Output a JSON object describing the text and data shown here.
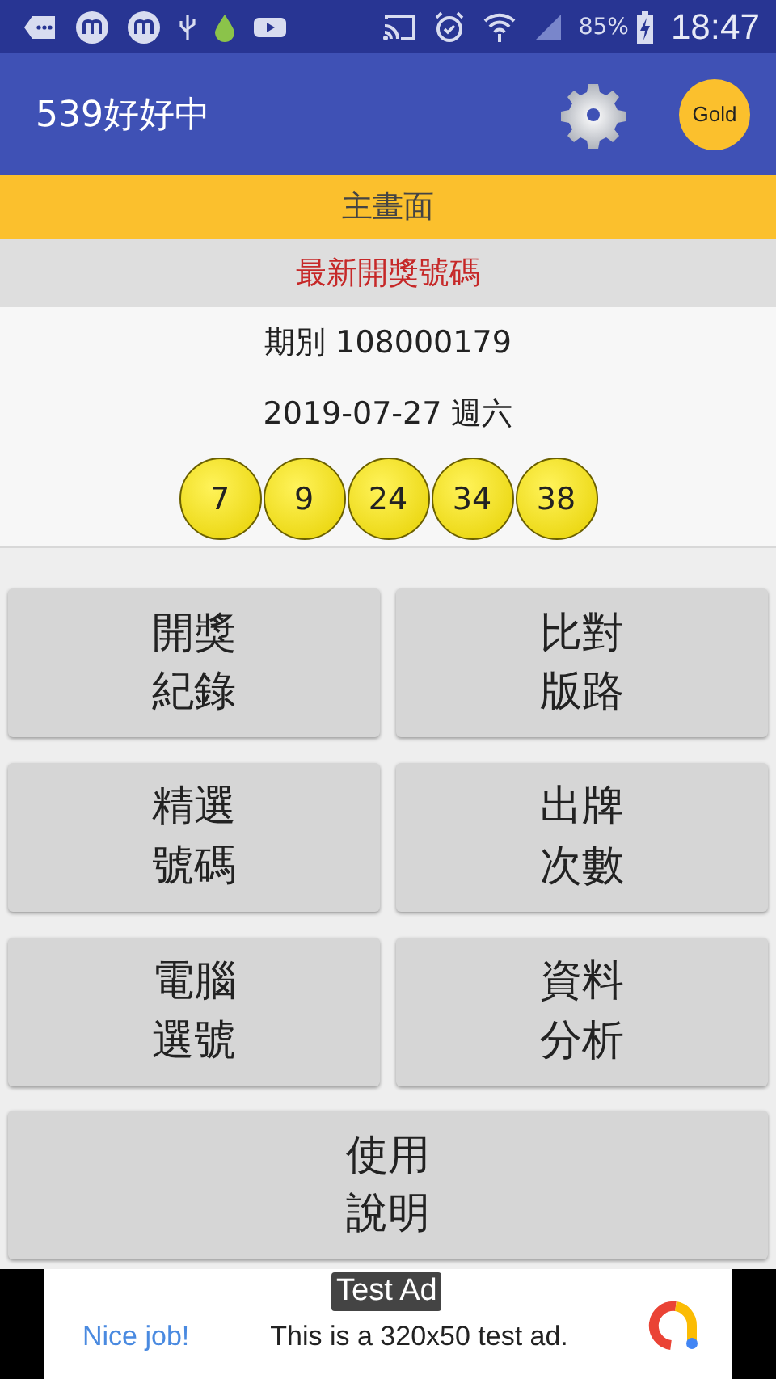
{
  "status_bar": {
    "battery_percent": "85%",
    "time": "18:47"
  },
  "app_bar": {
    "title": "539好好中",
    "badge": "Gold"
  },
  "tab_bar": {
    "label": "主畫面"
  },
  "latest": {
    "heading": "最新開獎號碼",
    "period": "期別 108000179",
    "date": "2019-07-27 週六",
    "balls": [
      "7",
      "9",
      "24",
      "34",
      "38"
    ]
  },
  "menu_buttons": [
    {
      "label": "開獎紀錄"
    },
    {
      "label": "比對版路"
    },
    {
      "label": "精選號碼"
    },
    {
      "label": "出牌次數"
    },
    {
      "label": "電腦選號"
    },
    {
      "label": "資料分析"
    },
    {
      "label": "使用說明"
    }
  ],
  "ad": {
    "tag": "Test Ad",
    "headline": "Nice job!",
    "text": "This is a 320x50 test ad."
  }
}
